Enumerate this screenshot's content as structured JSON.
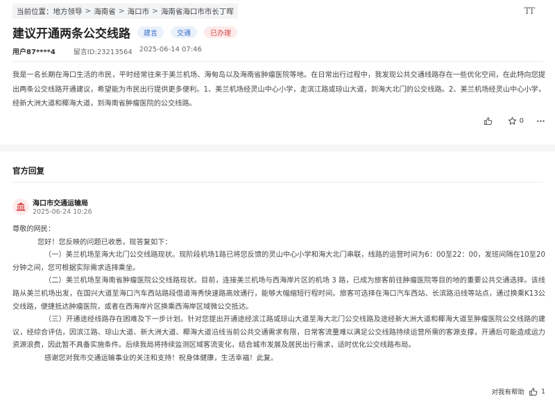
{
  "breadcrumb": {
    "prefix": "当前位置：",
    "items": [
      "地方领导",
      "海南省",
      "海口市",
      "海南省海口市市长丁晖"
    ],
    "separator": ">"
  },
  "font_toggle": "TT",
  "header": {
    "title": "建议开通两条公交线路",
    "tags": [
      "建言",
      "交通",
      "已办理"
    ]
  },
  "meta": {
    "user": "用户87****4",
    "message_id": "留言ID:23213564",
    "datetime": "2025-06-14 07:46"
  },
  "message": {
    "body": "我是一名长期在海口生活的市民，平时经常往来于美兰机场、海甸岛以及海南省肿瘤医院等地。在日常出行过程中，我发现公共交通线路存在一些优化空间，在此特向您提出两条公交线路开通建议，希望能为市民出行提供更多便利。1、美兰机场经灵山中心小学，走滨江路或琼山大道，到海大北门的公交线路。2、美兰机场经灵山中心小学，经新大洲大道和椰海大道，到海南省肿瘤医院的公交线路。",
    "like_count": "",
    "star_count": "0"
  },
  "reply_section": {
    "title": "官方回复",
    "org_name": "海口市交通运输局",
    "time": "2025-06-24 10:26",
    "greeting": "尊敬的网民：",
    "opening": "您好！您反映的问题已收悉，现答复如下：",
    "para1": "（一）美兰机场至海大北门公交线路现状。现阶段机场1路已将您反馈的灵山中心小学和海大北门串联，线路的运营时间为6：00至22：00，发班间隔在10至20分钟之间，您可根据实际需求选择乘坐。",
    "para2": "（二）美兰机场至海南省肿瘤医院公交线路现状。目前，连接美兰机场与西海岸片区的机场 3 路，已成为旅客前往肿瘤医院等目的地的重要公共交通选择。该线路从美兰机场出发，在国兴大道至海口汽车西站路段借道海秀快速路高效通行，能够大幅缩短行程时间。旅客可选择在海口汽车西站、长滨路沿线等站点，通过换乘K13公交线路，便捷抵达肿瘤医院，或者在西海岸片区换乘西海岸区域微公交抵达。",
    "para3": "（三）开通途经线路存在困难及下一步计划。针对您提出开通途经滨江路或琼山大道至海大北门公交线路及途经新大洲大道和椰海大道至肿瘤医院公交线路的建议，经综合评估，因滨江路、琼山大道、新大洲大道、椰海大道沿线当前公共交通需求有限，日常客流量难以满足公交线路持续运营所需的客源支撑，开通后可能造成运力资源浪费，因此暂不具备实施条件。后续我局将持续监测区域客流变化，结合城市发展及居民出行需求，适时优化公交线路布局。",
    "closing": "感谢您对我市交通运输事业的关注和支持！祝身体健康，生活幸福！此复。"
  },
  "helpful": {
    "label": "对我有帮助",
    "count": "1"
  },
  "colors": {
    "tag_blue_bg": "#eaf1fb",
    "tag_blue_text": "#3a6fc4",
    "tag_red_bg": "#fdeaea",
    "tag_red_text": "#d54a4a",
    "avatar_red": "#d64040"
  }
}
